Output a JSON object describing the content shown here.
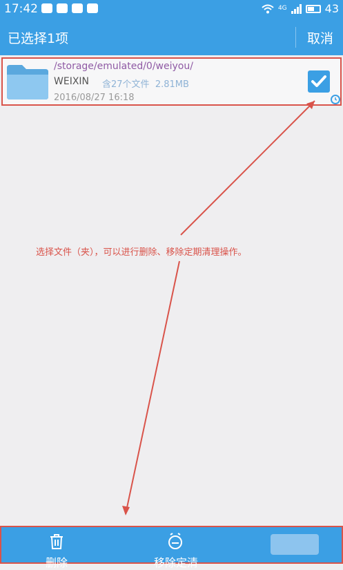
{
  "status": {
    "time": "17:42",
    "network": "4G",
    "battery": "43"
  },
  "appbar": {
    "title": "已选择1项",
    "cancel": "取消"
  },
  "file": {
    "path": "/storage/emulated/0/weiyou/",
    "name": "WEIXIN",
    "count_text": "含27个文件",
    "size": "2.81MB",
    "date": "2016/08/27 16:18",
    "checked": true
  },
  "annotation": "选择文件（夹），可以进行删除、移除定期清理操作。",
  "bottom": {
    "delete": "删除",
    "remove_schedule": "移除定清"
  },
  "colors": {
    "primary": "#3b9fe4",
    "annotation": "#d9534a",
    "background": "#efeef0"
  },
  "icons": [
    "wifi-icon",
    "signal-icon",
    "battery-icon",
    "folder-icon",
    "checkbox-icon",
    "clock-icon",
    "trash-icon",
    "schedule-remove-icon"
  ]
}
